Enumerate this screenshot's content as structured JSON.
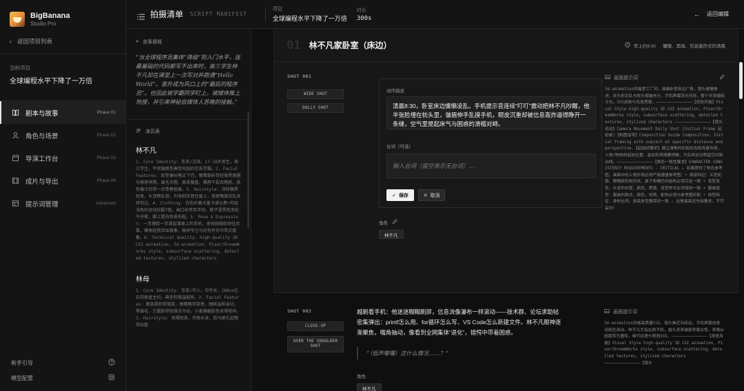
{
  "brand": {
    "name": "BigBanana",
    "sub": "Studio Pro"
  },
  "sidebar": {
    "back": "返回项目列表",
    "current_label": "当前项目",
    "current_name": "全球编程水平下降了一万倍",
    "nav": [
      {
        "label": "剧本与故事",
        "phase": "Phase 01",
        "icon": "book-icon"
      },
      {
        "label": "角色与场景",
        "phase": "Phase 02",
        "icon": "user-icon"
      },
      {
        "label": "导演工作台",
        "phase": "Phase 03",
        "icon": "clapper-icon"
      },
      {
        "label": "成片与导出",
        "phase": "Phase 04",
        "icon": "film-icon"
      },
      {
        "label": "提示词管理",
        "phase": "Advanced",
        "icon": "layers-icon"
      }
    ],
    "help": "新手引导",
    "model": "模型配置"
  },
  "header": {
    "title": "拍摄清单",
    "subtitle": "SCRIPT MANIFEST",
    "project_label": "项目",
    "project_value": "全球编程水平下降了一万倍",
    "duration_label": "时长",
    "duration_value": "300s",
    "back": "返回编辑"
  },
  "notes": {
    "story_title": "故事梗概",
    "story": "“当全球程序员集体“降级”到入门水平，连最基础的代码都写不出来时，高三学生林不凡却在课堂上一次写对并跑通“Hello World”。意外成为风口上的“最后的程序员”。也因此被学霸同学盯上，被媒体推上热搜，并引来神秘自媒体人苏晚的接触。”",
    "cast_title": "演员表",
    "characters": [
      {
        "name": "林不凡",
        "desc": "1. Core Identity: 东亚/汉族，17-18岁男生，高三学生，平常偏瘦型典型校园的宅系学霸。2. Facial Features: 脸型偏长略尖下巴，眼睛细长带轻微黑眼圈与倦意神情，眉毛浓粗，鼻梁偏直，嘴唇干裂且略抿，肤色偏冷白带一点青春痘痕。3. Hairstyle: 深棕偏黑短发，头顶略乱翘，刘海斜压遮住眉上，发尾略微凌乱未修剪过。4. Clothing: 白色印着大量卡通元素+内层浅色的运动校服T恤，袖口松垮且半旧，裤子是黑色宽松牛仔裤，脚上是白色帆布鞋。5. Pose & Expression: 一手撑脸一手拿起课桌上的手机，身体微微前倾往后靠，嘴角轻抿但显疲惫，眼神专注与好奇并存中带点疲惫。6. Technical Quality: high-quality 3D CGI animation, 3d-animation, Pixar/DreamWorks style, subsurface scattering, detailed textures, stylized characters"
      },
      {
        "name": "林母",
        "desc": "1. Core Identity: 东亚/华人，中年女，168cm左右的家庭主妇，典型和蔼温婉系。2. Facial Features: 面容柔和带微笑，眼睛略带笑意，眼眸温和亲切，黑眉毛，方圆脸带轻微法令纹，小麦偏暖肤色显得慈祥。3. Hairstyle: 深褐短发，齐肩长发，低马尾扎起略带松散"
      }
    ]
  },
  "scene": {
    "number": "01",
    "title": "林不凡家卧室（床边）",
    "time": "早上约8:30",
    "mood": "慵懒、黑暗、信息轰炸式的清晨"
  },
  "shot1": {
    "label": "SHOT 001",
    "tags": [
      "WIDE SHOT",
      "DOLLY SHOT"
    ],
    "action_label": "动作描述",
    "action_text": "清晨8:30，卧室床边慵懒凌乱。手机提示音连续“叮叮”震动把林不凡吵醒，他半张脸埋在枕头里，皱眉伸手乱摸手机，眼皮沉重却被信息轰炸逼得睁开一条缝，空气里是起床气与困惑的滑稽对峙。",
    "dialog_label": "台词（可选）",
    "dialog_placeholder": "输入台词（留空表示无台词）...",
    "save": "保存",
    "cancel": "取消",
    "role_label": "角色",
    "role_chip": "林不凡",
    "prompt_title": "画面提示词",
    "prompt_text": "3d-animation风格梦工厂风，清晨卧室床边广角，镜头缓慢推进，床头柜杂乱与枕头褶皱充分，手机屏幕亮光闪烁，整个环境偏暗冷光，SSS皮肤与毛发质感。———————————————【视觉风格】Visual Style high-quality 3D CGI animation, Pixar/DreamWorks style, subsurface scattering, detailed textures, stylized characters ———————————————【镜头运动】Camera Movement Dolly Shot (Initial Frame 起始帧)【构图指导】Composition Guide Composition: Initial Framing with subject at specific distance and perspective.【起始帧要求】建立清晰的初始状态和场景布局，人物/物体的起始位置、姿态和表情要明确，为后续运动预留空间和动线。———————————————【角色一致性要求】CHARACTER CONSISTENCY REQUIREMENTS - CRITICAL ⚠ 如果提供了角色参考图，画面中的人物外观必须严格遵循参考图：• 面部特征：五官轮廓、眼睛颜色和形状、鼻子和嘴巴的结构必须完全一致 • 发型发色：头发的长度、颜色、质感、发型样式必须保持一致 • 服装造型：服装的款式、颜色、材质、配饰必须与参考图匹配 • 体型特征：身材比例、身高体型要保持一致 ⚠ 这是最高优先级要求，不可妥协！"
  },
  "shot2": {
    "label": "SHOT 002",
    "tags": [
      "CLOSE-UP",
      "OVER THE SHOULDER SHOT"
    ],
    "action_text": "越刷看手机：他迷迷糊糊刷屏，信息流像瀑布一样滚动——技术群、论坛求助帖密集弹出：printf怎么用、for循环怎么写、VS Code怎么新建文件。林不凡眼神逐渐聚焦，嘴角抽动，像看到全网集体“退化”，错愕中带着困惑。",
    "quote": "“（低声嘟囔）这什么情况……？”",
    "role_label": "角色",
    "role_chip": "林不凡",
    "prompt_title": "画面提示词",
    "prompt_text": "3d-animation风格高质量CGI，镜头推近到床边，手机屏幕信息流疯狂滚动，林不凡手指在刷手机，眉头逐渐皱紧表情古怪，表情从困惑转为震惊，细节纹理与质感SSS。———————————————【视觉风格】Visual Style high-quality 3D CGI animation, Pixar/DreamWorks style, subsurface scattering, detailed textures, stylized characters ———————————————【镜头"
  }
}
